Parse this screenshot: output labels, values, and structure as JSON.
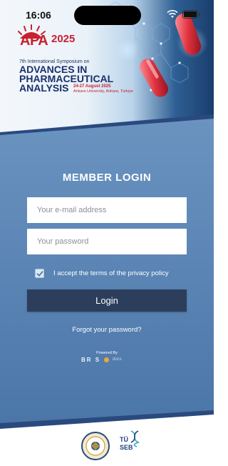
{
  "status_bar": {
    "time": "16:06"
  },
  "banner": {
    "logo_text": "APA",
    "logo_year": "2025",
    "symposium_line": "7th International Symposium on",
    "title_lines": [
      "ADVANCES IN",
      "PHARMACEUTICAL",
      "ANALYSIS"
    ],
    "dates": "24-27 August 2025",
    "venue": "Ankara University, Ankara, Türkiye"
  },
  "login": {
    "title": "MEMBER LOGIN",
    "email_placeholder": "Your e-mail address",
    "password_placeholder": "Your password",
    "terms_checked": true,
    "terms_label": "I accept the terms of the privacy policy",
    "login_button": "Login",
    "forgot_link": "Forgot your password?"
  },
  "powered_by": {
    "label": "Powered By",
    "brand_left": "BR  S",
    "brand_right": "docs"
  },
  "footer": {
    "partner_1": "ankara-university-seal",
    "partner_2_line1": "TÜ",
    "partner_2_line2": "SEB"
  },
  "colors": {
    "panel_blue": "#5b86b7",
    "button_navy": "#2c3e5c",
    "accent_red": "#c8202f"
  }
}
